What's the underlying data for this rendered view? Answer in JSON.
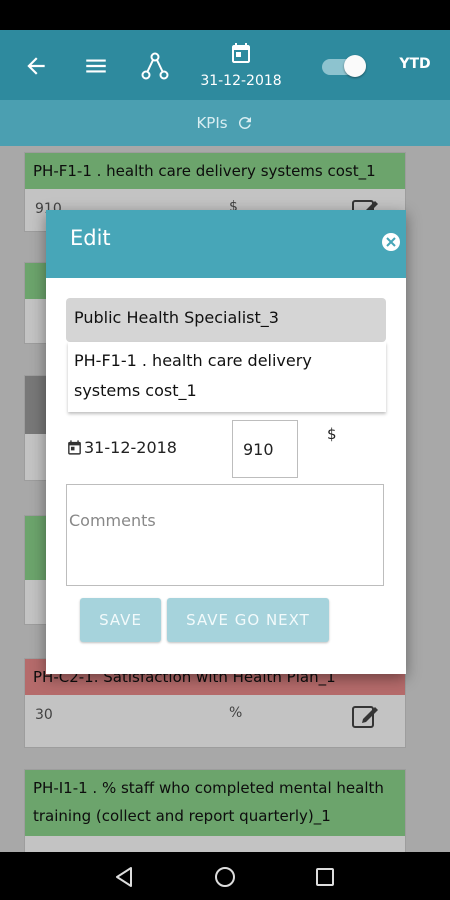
{
  "app_bar": {
    "date": "31-12-2018",
    "period_label": "YTD",
    "colors": {
      "bar": "#2e8a9e",
      "sub_bar": "#4b9fb1"
    },
    "icons": [
      "back-arrow-icon",
      "menu-icon",
      "hierarchy-icon",
      "calendar-icon",
      "toggle-switch"
    ]
  },
  "kpi_bar": {
    "label": "KPIs",
    "icon": "refresh-icon"
  },
  "cards": [
    {
      "title": "PH-F1-1 . health care delivery systems cost_1",
      "value": "910",
      "unit": "$",
      "status_color": "#8bd28b"
    },
    {
      "title": "PH-C2-1. Satisfaction with Health Plan_1",
      "value": "30",
      "unit": "%",
      "status_color": "#e88a8a"
    },
    {
      "title": "PH-I1-1 . % staff who completed mental health training (collect and report quarterly)_1",
      "status_color": "#8bd28b"
    }
  ],
  "dialog": {
    "title": "Edit",
    "person": "Public Health Specialist_3",
    "kpi": "PH-F1-1 . health care delivery systems cost_1",
    "date": "31-12-2018",
    "value": "910",
    "unit": "$",
    "comments_placeholder": "Comments",
    "save_label": "SAVE",
    "save_next_label": "SAVE GO NEXT",
    "header_color": "#47a6b8",
    "button_color": "#a6d3dc"
  }
}
